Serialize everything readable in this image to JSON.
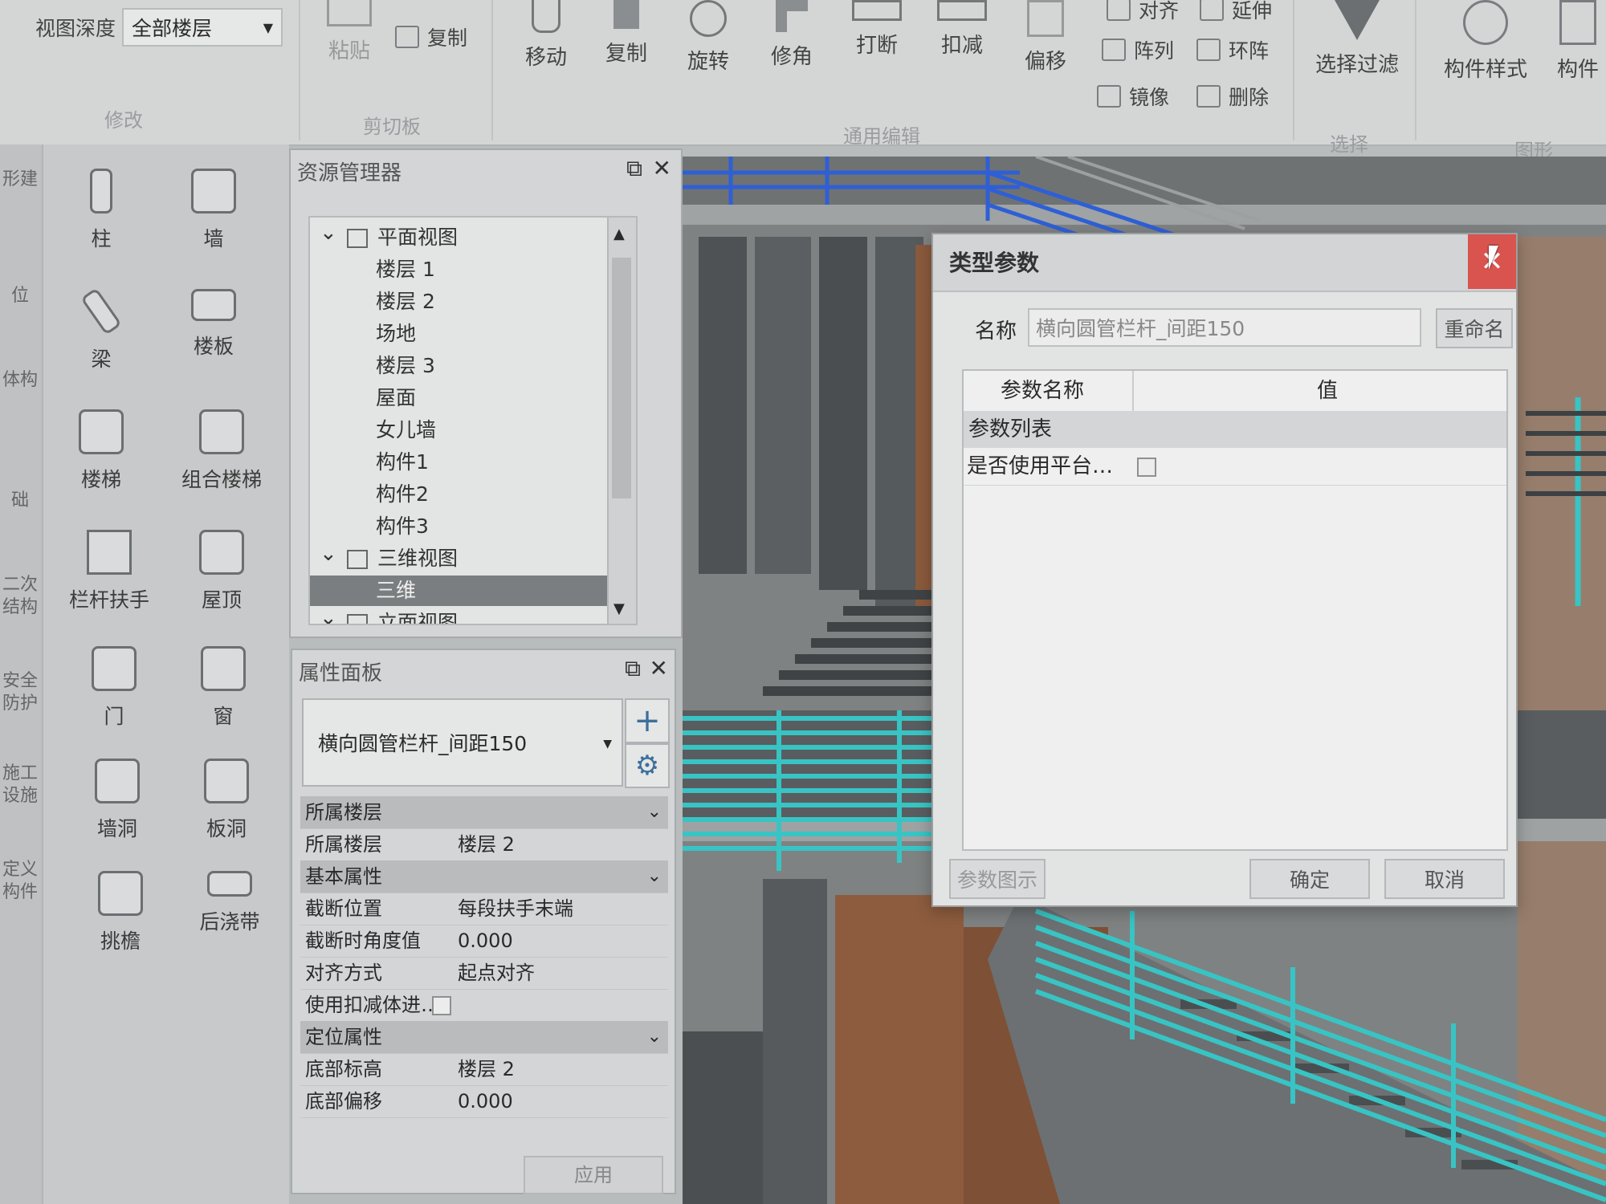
{
  "ribbon": {
    "view_depth_label": "视图深度",
    "view_depth_value": "全部楼层",
    "modify_group": "修改",
    "clipboard_group": "剪切板",
    "paste": "粘贴",
    "copy_clip": "复制",
    "common_edit_group": "通用编辑",
    "move": "移动",
    "copy": "复制",
    "rotate": "旋转",
    "trim": "修角",
    "break": "打断",
    "subtract": "扣减",
    "offset": "偏移",
    "align": "对齐",
    "extend": "延伸",
    "array": "阵列",
    "ring_array": "环阵",
    "mirror": "镜像",
    "delete": "删除",
    "select_group": "选择",
    "select_filter": "选择过滤",
    "graphics_group": "图形",
    "component_style": "构件样式",
    "component_partial": "构件"
  },
  "palette": {
    "categories": [
      "形建",
      "位",
      "体构",
      "础",
      "二次结构",
      "安全防护",
      "施工设施",
      "定义构件"
    ],
    "tools": [
      {
        "label": "柱",
        "icon": "column-icon"
      },
      {
        "label": "墙",
        "icon": "wall-icon"
      },
      {
        "label": "梁",
        "icon": "beam-icon"
      },
      {
        "label": "楼板",
        "icon": "slab-icon"
      },
      {
        "label": "楼梯",
        "icon": "stairs-icon"
      },
      {
        "label": "组合楼梯",
        "icon": "combined-stairs-icon"
      },
      {
        "label": "栏杆扶手",
        "icon": "railing-icon"
      },
      {
        "label": "屋顶",
        "icon": "roof-icon"
      },
      {
        "label": "门",
        "icon": "door-icon"
      },
      {
        "label": "窗",
        "icon": "window-icon"
      },
      {
        "label": "墙洞",
        "icon": "wall-opening-icon"
      },
      {
        "label": "板洞",
        "icon": "slab-opening-icon"
      },
      {
        "label": "挑檐",
        "icon": "eave-icon"
      },
      {
        "label": "后浇带",
        "icon": "post-cast-strip-icon"
      }
    ]
  },
  "resource_manager": {
    "title": "资源管理器",
    "tree": [
      {
        "label": "平面视图",
        "level": 0,
        "expanded": true
      },
      {
        "label": "楼层 1",
        "level": 1
      },
      {
        "label": "楼层 2",
        "level": 1
      },
      {
        "label": "场地",
        "level": 1
      },
      {
        "label": "楼层 3",
        "level": 1
      },
      {
        "label": "屋面",
        "level": 1
      },
      {
        "label": "女儿墙",
        "level": 1
      },
      {
        "label": "构件1",
        "level": 1
      },
      {
        "label": "构件2",
        "level": 1
      },
      {
        "label": "构件3",
        "level": 1
      },
      {
        "label": "三维视图",
        "level": 0,
        "expanded": true
      },
      {
        "label": "三维",
        "level": 1,
        "selected": true
      },
      {
        "label": "立面视图",
        "level": 0,
        "expanded": true
      }
    ]
  },
  "property_panel": {
    "title": "属性面板",
    "type_value": "横向圆管栏杆_间距150",
    "rows": [
      {
        "type": "head",
        "label": "所属楼层"
      },
      {
        "type": "row",
        "key": "所属楼层",
        "value": "楼层 2"
      },
      {
        "type": "head",
        "label": "基本属性"
      },
      {
        "type": "row",
        "key": "截断位置",
        "value": "每段扶手末端"
      },
      {
        "type": "row",
        "key": "截断时角度值",
        "value": "0.000"
      },
      {
        "type": "row",
        "key": "对齐方式",
        "value": "起点对齐"
      },
      {
        "type": "check",
        "key": "使用扣减体进…",
        "value": ""
      },
      {
        "type": "head",
        "label": "定位属性"
      },
      {
        "type": "row",
        "key": "底部标高",
        "value": "楼层 2"
      },
      {
        "type": "row",
        "key": "底部偏移",
        "value": "0.000"
      }
    ],
    "apply": "应用"
  },
  "dialog": {
    "title": "类型参数",
    "name_label": "名称",
    "name_value": "横向圆管栏杆_间距150",
    "rename": "重命名",
    "col_param": "参数名称",
    "col_value": "值",
    "group": "参数列表",
    "param_row": "是否使用平台…",
    "param_diagram": "参数图示",
    "ok": "确定",
    "cancel": "取消"
  },
  "colors": {
    "railing_cyan": "#38c4c4",
    "railing_blue": "#2e5fd6",
    "wood": "#8a5a3c",
    "close_red": "#d9534f"
  }
}
